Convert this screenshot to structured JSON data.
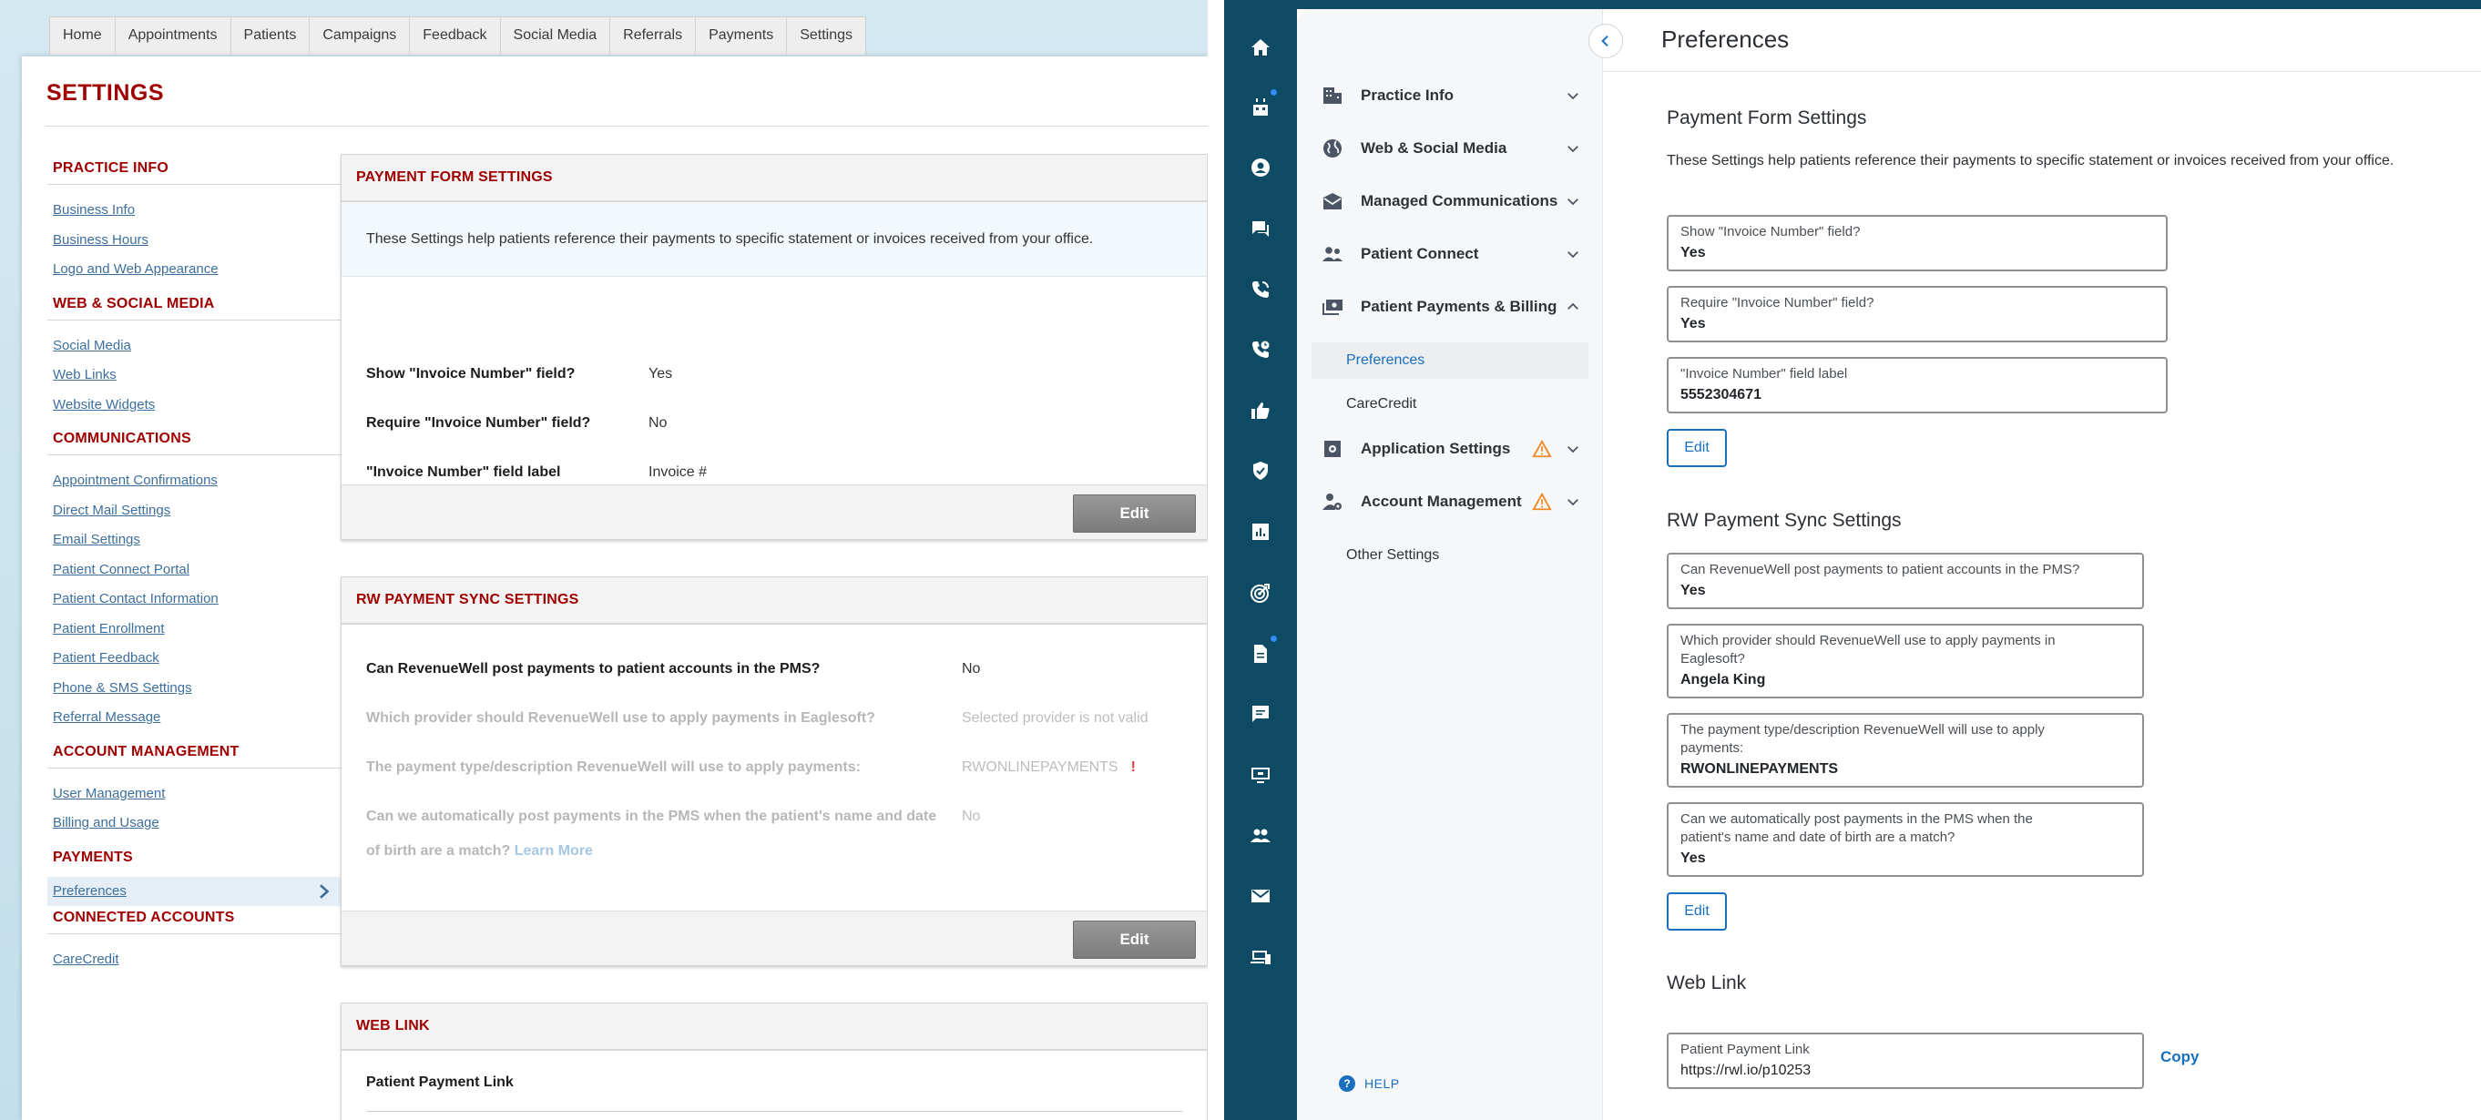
{
  "legacy": {
    "nav_tabs": [
      "Home",
      "Appointments",
      "Patients",
      "Campaigns",
      "Feedback",
      "Social Media",
      "Referrals",
      "Payments",
      "Settings"
    ],
    "title": "SETTINGS",
    "sidebar": {
      "practice_info": {
        "heading": "PRACTICE INFO",
        "links": [
          "Business Info",
          "Business Hours",
          "Logo and Web Appearance"
        ]
      },
      "web_social": {
        "heading": "WEB & SOCIAL MEDIA",
        "links": [
          "Social Media",
          "Web Links",
          "Website Widgets"
        ]
      },
      "communications": {
        "heading": "COMMUNICATIONS",
        "links": [
          "Appointment Confirmations",
          "Direct Mail Settings",
          "Email Settings",
          "Patient Connect Portal",
          "Patient Contact Information",
          "Patient Enrollment",
          "Patient Feedback",
          "Phone & SMS Settings",
          "Referral Message"
        ]
      },
      "account_mgmt": {
        "heading": "ACCOUNT MANAGEMENT",
        "links": [
          "User Management",
          "Billing and Usage"
        ]
      },
      "payments": {
        "heading": "PAYMENTS",
        "active_link": "Preferences"
      },
      "connected": {
        "heading": "CONNECTED ACCOUNTS",
        "links": [
          "CareCredit"
        ]
      }
    },
    "payment_form": {
      "heading": "PAYMENT FORM SETTINGS",
      "description": "These Settings help patients reference their payments to specific statement or invoices received from your office.",
      "rows": [
        {
          "label": "Show \"Invoice Number\" field?",
          "value": "Yes"
        },
        {
          "label": "Require \"Invoice Number\" field?",
          "value": "No"
        },
        {
          "label": "\"Invoice Number\" field label",
          "value": "Invoice #"
        }
      ],
      "edit_label": "Edit"
    },
    "rw_sync": {
      "heading": "RW PAYMENT SYNC SETTINGS",
      "rows": [
        {
          "label": "Can RevenueWell post payments to patient accounts in the PMS?",
          "value": "No"
        },
        {
          "label": "Which provider should RevenueWell use to apply payments in Eaglesoft?",
          "value": "Selected provider is not valid"
        },
        {
          "label": "The payment type/description RevenueWell will use to apply payments:",
          "value": "RWONLINEPAYMENTS",
          "alert": "!"
        },
        {
          "label_line1": "Can we automatically post payments in the PMS when the patient's name and date",
          "label_line2": "of birth are a match?",
          "learn_more": "Learn More",
          "value": "No"
        }
      ],
      "edit_label": "Edit"
    },
    "web_link": {
      "heading": "WEB LINK",
      "row_label": "Patient Payment Link"
    }
  },
  "modern": {
    "page_title": "Preferences",
    "rail_icons": [
      "home-icon",
      "calendar-icon",
      "person-icon",
      "chat-icon",
      "phone-icon",
      "phone-clock-icon",
      "thumbs-up-icon",
      "shield-icon",
      "chart-icon",
      "target-icon",
      "document-icon",
      "message-icon",
      "monitor-icon",
      "group-icon",
      "mail-icon",
      "devices-icon"
    ],
    "nav": {
      "practice_info": "Practice Info",
      "web_social": "Web & Social Media",
      "managed_comms": "Managed Communications",
      "patient_connect": "Patient Connect",
      "patient_payments": "Patient Payments & Billing",
      "sub_preferences": "Preferences",
      "sub_carecredit": "CareCredit",
      "application_settings": "Application Settings",
      "account_management": "Account Management",
      "other_settings": "Other Settings",
      "help": "HELP"
    },
    "payment_form": {
      "title": "Payment Form Settings",
      "description": "These Settings help patients reference their payments to specific statement or invoices received from your office.",
      "fields": [
        {
          "label": "Show \"Invoice Number\" field?",
          "value": "Yes"
        },
        {
          "label": "Require \"Invoice Number\" field?",
          "value": "Yes"
        },
        {
          "label": "\"Invoice Number\" field label",
          "value": "5552304671"
        }
      ],
      "edit_label": "Edit"
    },
    "rw_sync": {
      "title": "RW Payment Sync Settings",
      "fields": [
        {
          "label": "Can RevenueWell post payments to patient accounts in the PMS?",
          "value": "Yes"
        },
        {
          "label_line1": "Which provider should RevenueWell use to apply payments in",
          "label_line2": "Eaglesoft?",
          "value": "Angela King"
        },
        {
          "label_line1": "The payment type/description RevenueWell will use to apply",
          "label_line2": "payments:",
          "value": "RWONLINEPAYMENTS"
        },
        {
          "label_line1": "Can we automatically post payments in the PMS when the",
          "label_line2": "patient's name and date of birth are a match?",
          "value": "Yes"
        }
      ],
      "edit_label": "Edit"
    },
    "web_link": {
      "title": "Web Link",
      "field_label": "Patient Payment Link",
      "field_value": "https://rwl.io/p10253",
      "copy_label": "Copy"
    },
    "colors": {
      "rail": "#0e4a63",
      "accent": "#1a6fbf",
      "warning": "#f08a24"
    }
  }
}
